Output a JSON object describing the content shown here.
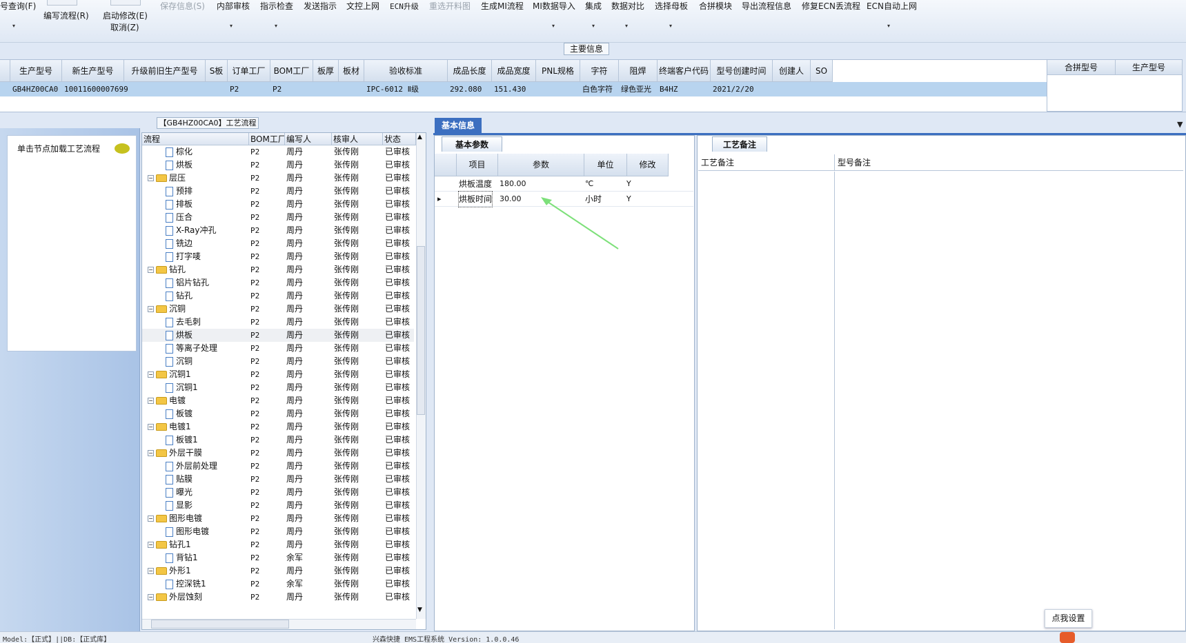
{
  "toolbar": {
    "items": [
      {
        "label": "号查询(F)",
        "disabled": false
      },
      {
        "label": "编写流程(R)",
        "disabled": false
      },
      {
        "label": "启动修改(E)",
        "disabled": false
      },
      {
        "label": "取消(Z)",
        "disabled": false
      },
      {
        "label": "保存信息(S)",
        "disabled": true
      },
      {
        "label": "内部审核",
        "disabled": false
      },
      {
        "label": "指示检查",
        "disabled": false
      },
      {
        "label": "发送指示",
        "disabled": false
      },
      {
        "label": "文控上网",
        "disabled": false
      },
      {
        "label": "ECN升级",
        "disabled": false
      },
      {
        "label": "重选开料图",
        "disabled": true
      },
      {
        "label": "生成MI流程",
        "disabled": false
      },
      {
        "label": "MI数据导入",
        "disabled": false
      },
      {
        "label": "集成",
        "disabled": false
      },
      {
        "label": "数据对比",
        "disabled": false
      },
      {
        "label": "选择母板",
        "disabled": false
      },
      {
        "label": "合拼模块",
        "disabled": false
      },
      {
        "label": "导出流程信息",
        "disabled": false
      },
      {
        "label": "修复ECN丢流程",
        "disabled": false
      },
      {
        "label": "ECN自动上网",
        "disabled": false
      }
    ]
  },
  "main_info": {
    "label": "主要信息",
    "columns": [
      "生产型号",
      "新生产型号",
      "升级前旧生产型号",
      "S板",
      "订单工厂",
      "BOM工厂",
      "板厚",
      "板材",
      "验收标准",
      "成品长度",
      "成品宽度",
      "PNL规格",
      "字符",
      "阻焊",
      "终端客户代码",
      "型号创建时间",
      "创建人",
      "SO"
    ],
    "row": [
      "GB4HZ00CA0",
      "10011600007699",
      "",
      "",
      "P2",
      "P2",
      "",
      "",
      "IPC-6012 Ⅱ级",
      "292.080",
      "151.430",
      "",
      "白色字符",
      "绿色亚光",
      "B4HZ",
      "2021/2/20",
      "",
      ""
    ],
    "right_columns": [
      "合拼型号",
      "生产型号"
    ]
  },
  "left_nav": {
    "item": "单击节点加载工艺流程"
  },
  "process": {
    "title": "【GB4HZ00CA0】工艺流程",
    "columns": [
      "流程",
      "BOM工厂",
      "编写人",
      "核审人",
      "状态"
    ],
    "rows": [
      {
        "name": "棕化",
        "level": 1,
        "type": "doc",
        "factory": "P2",
        "writer": "周丹",
        "reviewer": "张传刚",
        "status": "已审核"
      },
      {
        "name": "烘板",
        "level": 1,
        "type": "doc",
        "factory": "P2",
        "writer": "周丹",
        "reviewer": "张传刚",
        "status": "已审核"
      },
      {
        "name": "层压",
        "level": 0,
        "type": "folder",
        "factory": "P2",
        "writer": "周丹",
        "reviewer": "张传刚",
        "status": "已审核"
      },
      {
        "name": "预排",
        "level": 1,
        "type": "doc",
        "factory": "P2",
        "writer": "周丹",
        "reviewer": "张传刚",
        "status": "已审核"
      },
      {
        "name": "排板",
        "level": 1,
        "type": "doc",
        "factory": "P2",
        "writer": "周丹",
        "reviewer": "张传刚",
        "status": "已审核"
      },
      {
        "name": "压合",
        "level": 1,
        "type": "doc",
        "factory": "P2",
        "writer": "周丹",
        "reviewer": "张传刚",
        "status": "已审核"
      },
      {
        "name": "X-Ray冲孔",
        "level": 1,
        "type": "doc",
        "factory": "P2",
        "writer": "周丹",
        "reviewer": "张传刚",
        "status": "已审核"
      },
      {
        "name": "铣边",
        "level": 1,
        "type": "doc",
        "factory": "P2",
        "writer": "周丹",
        "reviewer": "张传刚",
        "status": "已审核"
      },
      {
        "name": "打字唛",
        "level": 1,
        "type": "doc",
        "factory": "P2",
        "writer": "周丹",
        "reviewer": "张传刚",
        "status": "已审核"
      },
      {
        "name": "钻孔",
        "level": 0,
        "type": "folder",
        "factory": "P2",
        "writer": "周丹",
        "reviewer": "张传刚",
        "status": "已审核"
      },
      {
        "name": "铝片钻孔",
        "level": 1,
        "type": "doc",
        "factory": "P2",
        "writer": "周丹",
        "reviewer": "张传刚",
        "status": "已审核"
      },
      {
        "name": "钻孔",
        "level": 1,
        "type": "doc",
        "factory": "P2",
        "writer": "周丹",
        "reviewer": "张传刚",
        "status": "已审核"
      },
      {
        "name": "沉铜",
        "level": 0,
        "type": "folder",
        "factory": "P2",
        "writer": "周丹",
        "reviewer": "张传刚",
        "status": "已审核"
      },
      {
        "name": "去毛刺",
        "level": 1,
        "type": "doc",
        "factory": "P2",
        "writer": "周丹",
        "reviewer": "张传刚",
        "status": "已审核"
      },
      {
        "name": "烘板",
        "level": 1,
        "type": "doc",
        "factory": "P2",
        "writer": "周丹",
        "reviewer": "张传刚",
        "status": "已审核",
        "selected": true
      },
      {
        "name": "等离子处理",
        "level": 1,
        "type": "doc",
        "factory": "P2",
        "writer": "周丹",
        "reviewer": "张传刚",
        "status": "已审核"
      },
      {
        "name": "沉铜",
        "level": 1,
        "type": "doc",
        "factory": "P2",
        "writer": "周丹",
        "reviewer": "张传刚",
        "status": "已审核"
      },
      {
        "name": "沉铜1",
        "level": 0,
        "type": "folder",
        "factory": "P2",
        "writer": "周丹",
        "reviewer": "张传刚",
        "status": "已审核"
      },
      {
        "name": "沉铜1",
        "level": 1,
        "type": "doc",
        "factory": "P2",
        "writer": "周丹",
        "reviewer": "张传刚",
        "status": "已审核"
      },
      {
        "name": "电镀",
        "level": 0,
        "type": "folder",
        "factory": "P2",
        "writer": "周丹",
        "reviewer": "张传刚",
        "status": "已审核"
      },
      {
        "name": "板镀",
        "level": 1,
        "type": "doc",
        "factory": "P2",
        "writer": "周丹",
        "reviewer": "张传刚",
        "status": "已审核"
      },
      {
        "name": "电镀1",
        "level": 0,
        "type": "folder",
        "factory": "P2",
        "writer": "周丹",
        "reviewer": "张传刚",
        "status": "已审核"
      },
      {
        "name": "板镀1",
        "level": 1,
        "type": "doc",
        "factory": "P2",
        "writer": "周丹",
        "reviewer": "张传刚",
        "status": "已审核"
      },
      {
        "name": "外层干膜",
        "level": 0,
        "type": "folder",
        "factory": "P2",
        "writer": "周丹",
        "reviewer": "张传刚",
        "status": "已审核"
      },
      {
        "name": "外层前处理",
        "level": 1,
        "type": "doc",
        "factory": "P2",
        "writer": "周丹",
        "reviewer": "张传刚",
        "status": "已审核"
      },
      {
        "name": "贴膜",
        "level": 1,
        "type": "doc",
        "factory": "P2",
        "writer": "周丹",
        "reviewer": "张传刚",
        "status": "已审核"
      },
      {
        "name": "曝光",
        "level": 1,
        "type": "doc",
        "factory": "P2",
        "writer": "周丹",
        "reviewer": "张传刚",
        "status": "已审核"
      },
      {
        "name": "显影",
        "level": 1,
        "type": "doc",
        "factory": "P2",
        "writer": "周丹",
        "reviewer": "张传刚",
        "status": "已审核"
      },
      {
        "name": "图形电镀",
        "level": 0,
        "type": "folder",
        "factory": "P2",
        "writer": "周丹",
        "reviewer": "张传刚",
        "status": "已审核"
      },
      {
        "name": "图形电镀",
        "level": 1,
        "type": "doc",
        "factory": "P2",
        "writer": "周丹",
        "reviewer": "张传刚",
        "status": "已审核"
      },
      {
        "name": "钻孔1",
        "level": 0,
        "type": "folder",
        "factory": "P2",
        "writer": "周丹",
        "reviewer": "张传刚",
        "status": "已审核"
      },
      {
        "name": "背钻1",
        "level": 1,
        "type": "doc",
        "factory": "P2",
        "writer": "余军",
        "reviewer": "张传刚",
        "status": "已审核"
      },
      {
        "name": "外形1",
        "level": 0,
        "type": "folder",
        "factory": "P2",
        "writer": "周丹",
        "reviewer": "张传刚",
        "status": "已审核"
      },
      {
        "name": "控深铣1",
        "level": 1,
        "type": "doc",
        "factory": "P2",
        "writer": "余军",
        "reviewer": "张传刚",
        "status": "已审核"
      },
      {
        "name": "外层蚀刻",
        "level": 0,
        "type": "folder",
        "factory": "P2",
        "writer": "周丹",
        "reviewer": "张传刚",
        "status": "已审核"
      }
    ]
  },
  "basic_info": {
    "tab": "基本信息",
    "param_tab": "基本参数",
    "columns": [
      "项目",
      "参数",
      "单位",
      "修改"
    ],
    "rows": [
      {
        "item": "烘板温度",
        "value": "180.00",
        "unit": "℃",
        "modified": "Y"
      },
      {
        "item": "烘板时间",
        "value": "30.00",
        "unit": "小时",
        "modified": "Y"
      }
    ],
    "annotation_arrow_color": "#7de07a"
  },
  "notes": {
    "tab": "工艺备注",
    "col1": "工艺备注",
    "col2": "型号备注"
  },
  "settings_button": "点我设置",
  "status": {
    "left": "Model:【正式】||DB:【正式库】",
    "center": "兴森快捷 EMS工程系统 Version: 1.0.0.46"
  },
  "colors": {
    "accent": "#3c6fc0",
    "selected_row": "#b8d4ef"
  }
}
